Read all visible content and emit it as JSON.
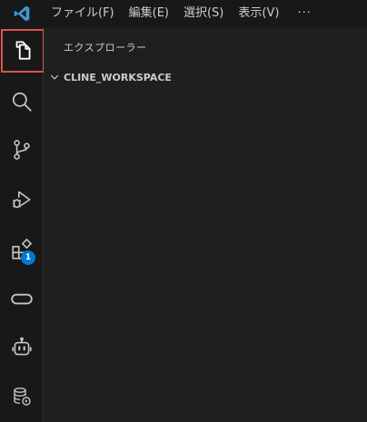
{
  "menubar": {
    "app_icon": "vscode-logo-icon",
    "items": [
      {
        "label": "ファイル(F)"
      },
      {
        "label": "編集(E)"
      },
      {
        "label": "選択(S)"
      },
      {
        "label": "表示(V)"
      }
    ],
    "more_label": "···",
    "colors": {
      "logo": "#3c99d4",
      "text": "#cccccc"
    }
  },
  "activitybar": {
    "items": [
      {
        "name": "explorer",
        "icon": "files-icon",
        "selected": true
      },
      {
        "name": "search",
        "icon": "search-icon"
      },
      {
        "name": "source-control",
        "icon": "source-control-icon"
      },
      {
        "name": "run-debug",
        "icon": "run-debug-icon"
      },
      {
        "name": "extensions",
        "icon": "extensions-icon",
        "badge": "1"
      },
      {
        "name": "remote",
        "icon": "remote-explorer-icon"
      },
      {
        "name": "copilot",
        "icon": "robot-icon"
      },
      {
        "name": "database",
        "icon": "database-icon"
      }
    ],
    "colors": {
      "icon": "#c5c5c5",
      "selected_icon": "#ffffff",
      "highlight_box": "#d9534f",
      "badge": "#0078d4"
    }
  },
  "sidebar": {
    "title": "エクスプローラー",
    "section": {
      "label": "CLINE_WORKSPACE",
      "expanded": true
    }
  }
}
